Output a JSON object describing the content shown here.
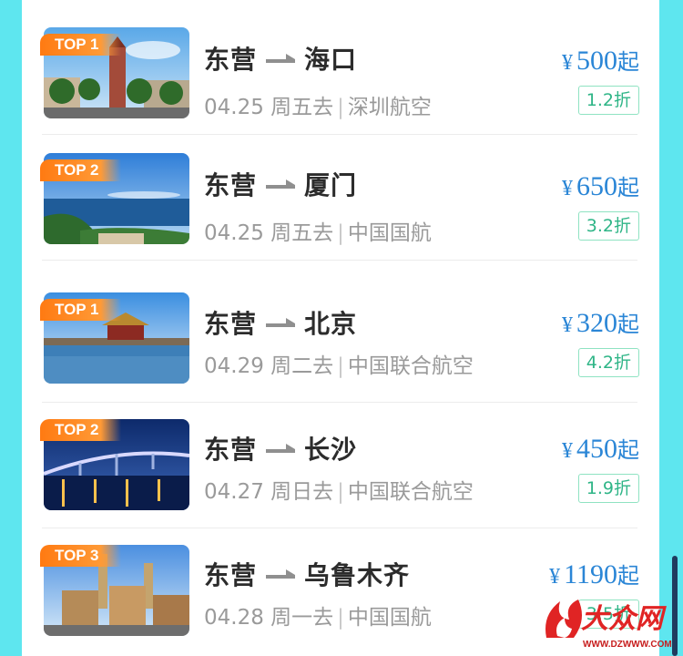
{
  "flights": [
    {
      "badge": "TOP 1",
      "from": "东营",
      "to": "海口",
      "date": "04.25",
      "weekday_go": "周五去",
      "airline": "深圳航空",
      "price": "500",
      "suffix": "起",
      "discount": "1.2折",
      "scene": "haikou"
    },
    {
      "badge": "TOP 2",
      "from": "东营",
      "to": "厦门",
      "date": "04.25",
      "weekday_go": "周五去",
      "airline": "中国国航",
      "price": "650",
      "suffix": "起",
      "discount": "3.2折",
      "scene": "xiamen"
    },
    {
      "badge": "TOP 1",
      "from": "东营",
      "to": "北京",
      "date": "04.29",
      "weekday_go": "周二去",
      "airline": "中国联合航空",
      "price": "320",
      "suffix": "起",
      "discount": "4.2折",
      "scene": "beijing"
    },
    {
      "badge": "TOP 2",
      "from": "东营",
      "to": "长沙",
      "date": "04.27",
      "weekday_go": "周日去",
      "airline": "中国联合航空",
      "price": "450",
      "suffix": "起",
      "discount": "1.9折",
      "scene": "changsha"
    },
    {
      "badge": "TOP 3",
      "from": "东营",
      "to": "乌鲁木齐",
      "date": "04.28",
      "weekday_go": "周一去",
      "airline": "中国国航",
      "price": "1190",
      "suffix": "起",
      "discount": "3.5折",
      "scene": "urumqi"
    }
  ],
  "currency": "¥",
  "watermark": {
    "brand": "大众网",
    "url": "WWW.DZWWW.COM"
  },
  "colors": {
    "background": "#5ee6ef",
    "price": "#2b86d6",
    "discount": "#2fb587",
    "badge": "#ff7a12"
  }
}
